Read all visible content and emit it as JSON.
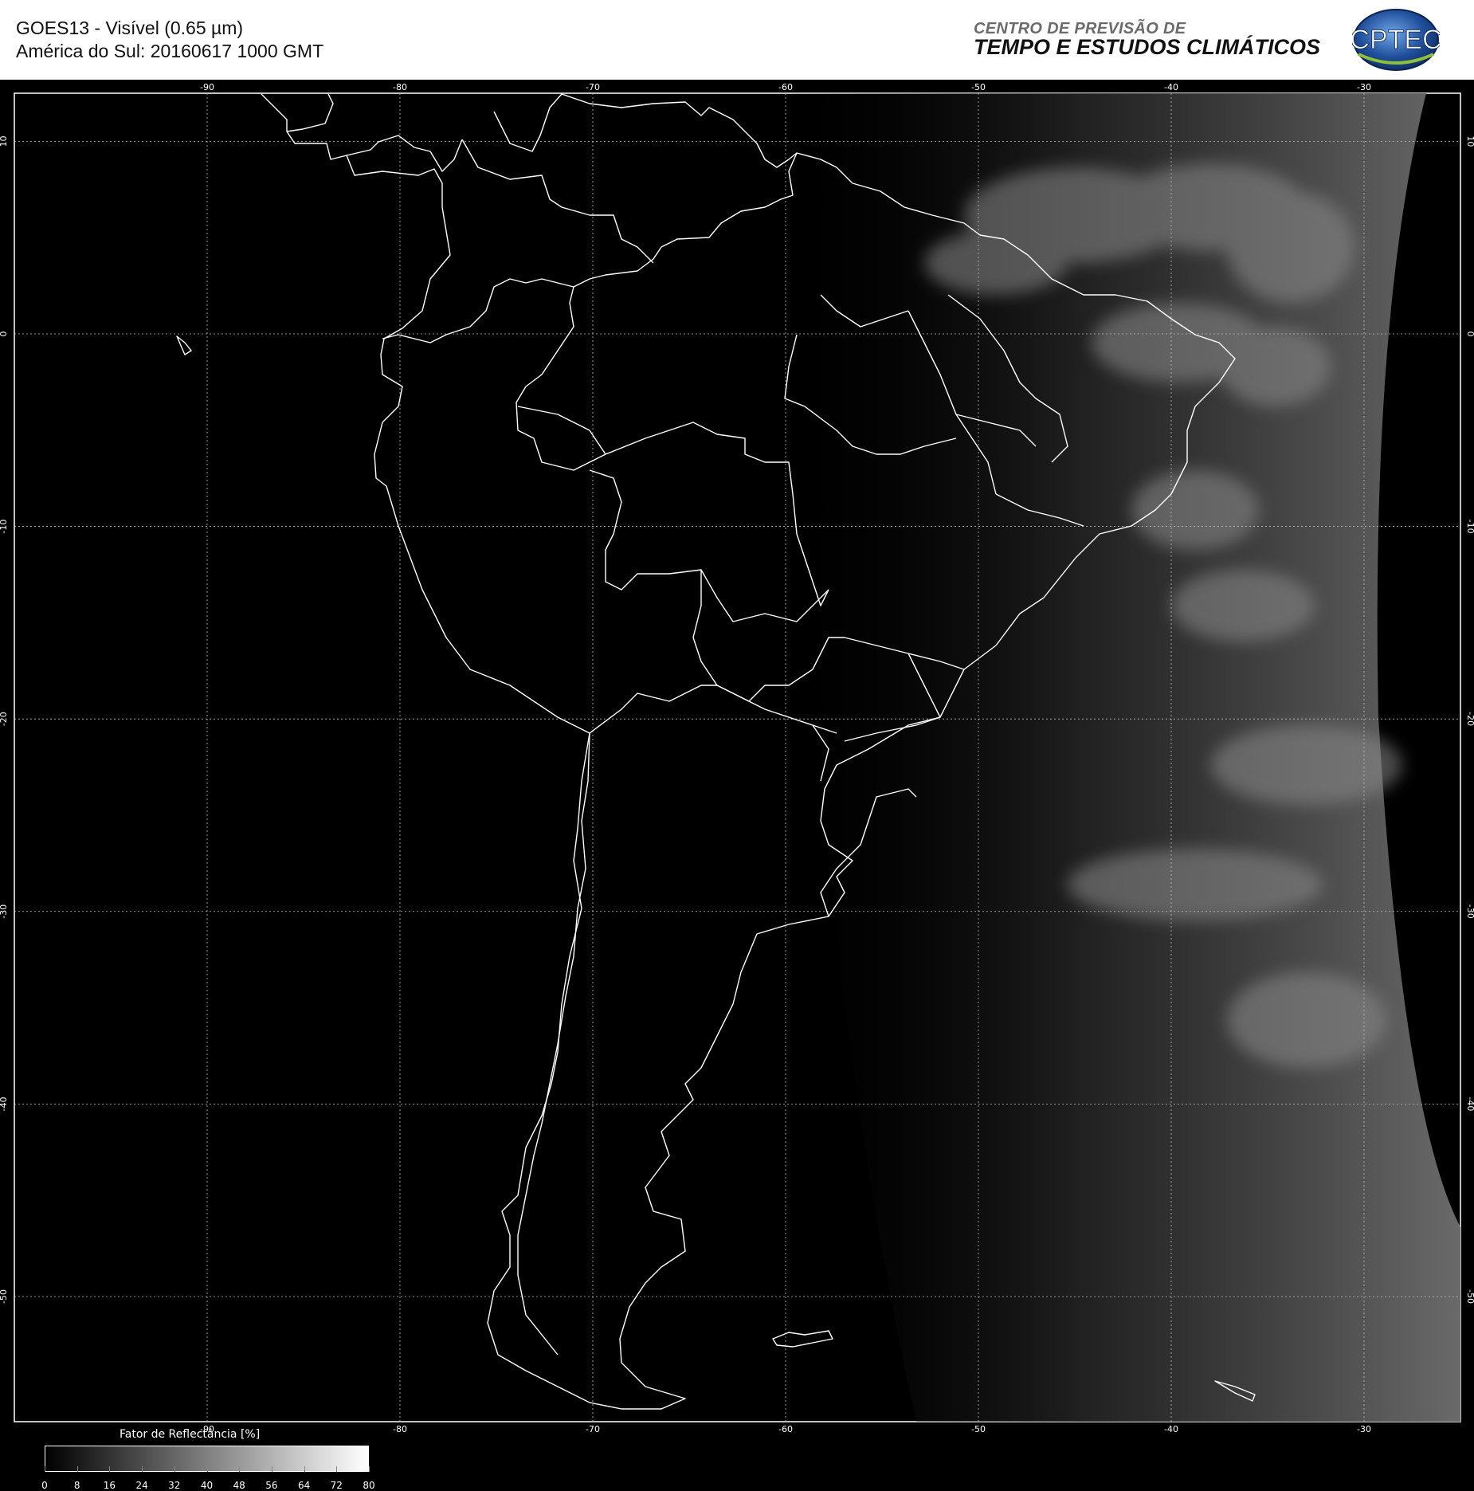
{
  "header": {
    "title_line1": "GOES13 - Visível (0.65 µm)",
    "title_line2": "América do Sul: 20160617 1000 GMT",
    "org_line1": "CENTRO DE PREVISÃO DE",
    "org_line2": "TEMPO E ESTUDOS CLIMÁTICOS",
    "logo_text": "CPTEC",
    "logo_color": "#1f4e9a"
  },
  "map": {
    "lon_range": [
      -100,
      -25
    ],
    "lat_range": [
      12.5,
      -56.5
    ],
    "lon_ticks": [
      "-90",
      "-80",
      "-70",
      "-60",
      "-50",
      "-40",
      "-30"
    ],
    "lat_ticks": [
      "10",
      "0",
      "-10",
      "-20",
      "-30",
      "-40",
      "-50"
    ],
    "grid": "dotted"
  },
  "legend": {
    "title": "Fator de Reflectância [%]",
    "labels": [
      "0",
      "8",
      "16",
      "24",
      "32",
      "40",
      "48",
      "56",
      "64",
      "72",
      "80"
    ],
    "gradient": [
      "#000000",
      "#ffffff"
    ]
  }
}
